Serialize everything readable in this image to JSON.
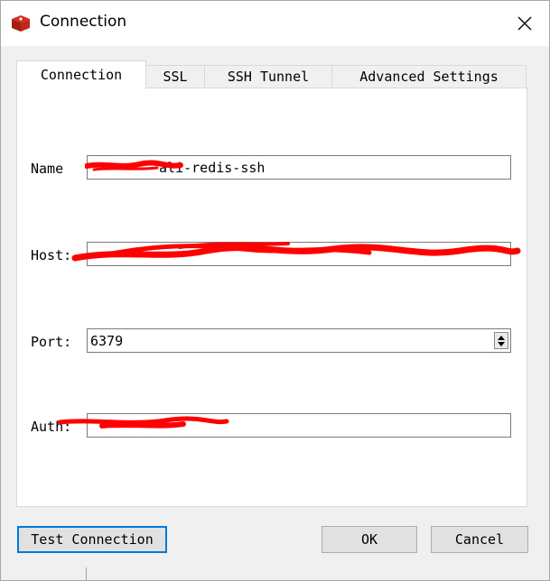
{
  "window": {
    "title": "Connection",
    "icon": "redis-logo-icon",
    "close_icon": "close-icon"
  },
  "tabs": [
    {
      "label": "Connection",
      "active": true
    },
    {
      "label": "SSL",
      "active": false
    },
    {
      "label": "SSH Tunnel",
      "active": false
    },
    {
      "label": "Advanced Settings",
      "active": false
    }
  ],
  "form": {
    "name": {
      "label": "Name",
      "value": "-ali-redis-ssh"
    },
    "host": {
      "label": "Host:",
      "value": ""
    },
    "port": {
      "label": "Port:",
      "value": "6379"
    },
    "auth": {
      "label": "Auth:",
      "value": ""
    }
  },
  "buttons": {
    "test_connection": "Test Connection",
    "ok": "OK",
    "cancel": "Cancel"
  },
  "colors": {
    "redaction": "#ff0000",
    "focus_border": "#0078d7",
    "brand_red": "#d82c20"
  }
}
